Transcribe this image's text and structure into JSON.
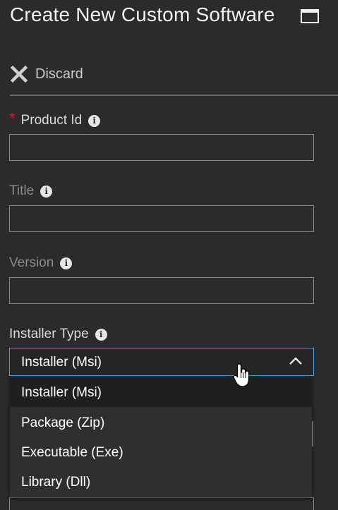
{
  "header": {
    "title": "Create New Custom Software",
    "maximize_icon": "maximize-icon"
  },
  "toolbar": {
    "discard_label": "Discard",
    "discard_icon": "close-x-icon"
  },
  "form": {
    "product_id": {
      "label": "Product Id",
      "required": true,
      "value": "",
      "info_icon": "info-icon"
    },
    "title": {
      "label": "Title",
      "value": "",
      "info_icon": "info-icon"
    },
    "version": {
      "label": "Version",
      "value": "",
      "info_icon": "info-icon"
    },
    "installer_type": {
      "label": "Installer Type",
      "selected": "Installer (Msi)",
      "options": [
        "Installer (Msi)",
        "Package (Zip)",
        "Executable (Exe)",
        "Library (Dll)"
      ],
      "expanded": true
    }
  },
  "colors": {
    "background": "#2b2b2b",
    "accent": "#4aa3df",
    "required": "#e81123"
  }
}
